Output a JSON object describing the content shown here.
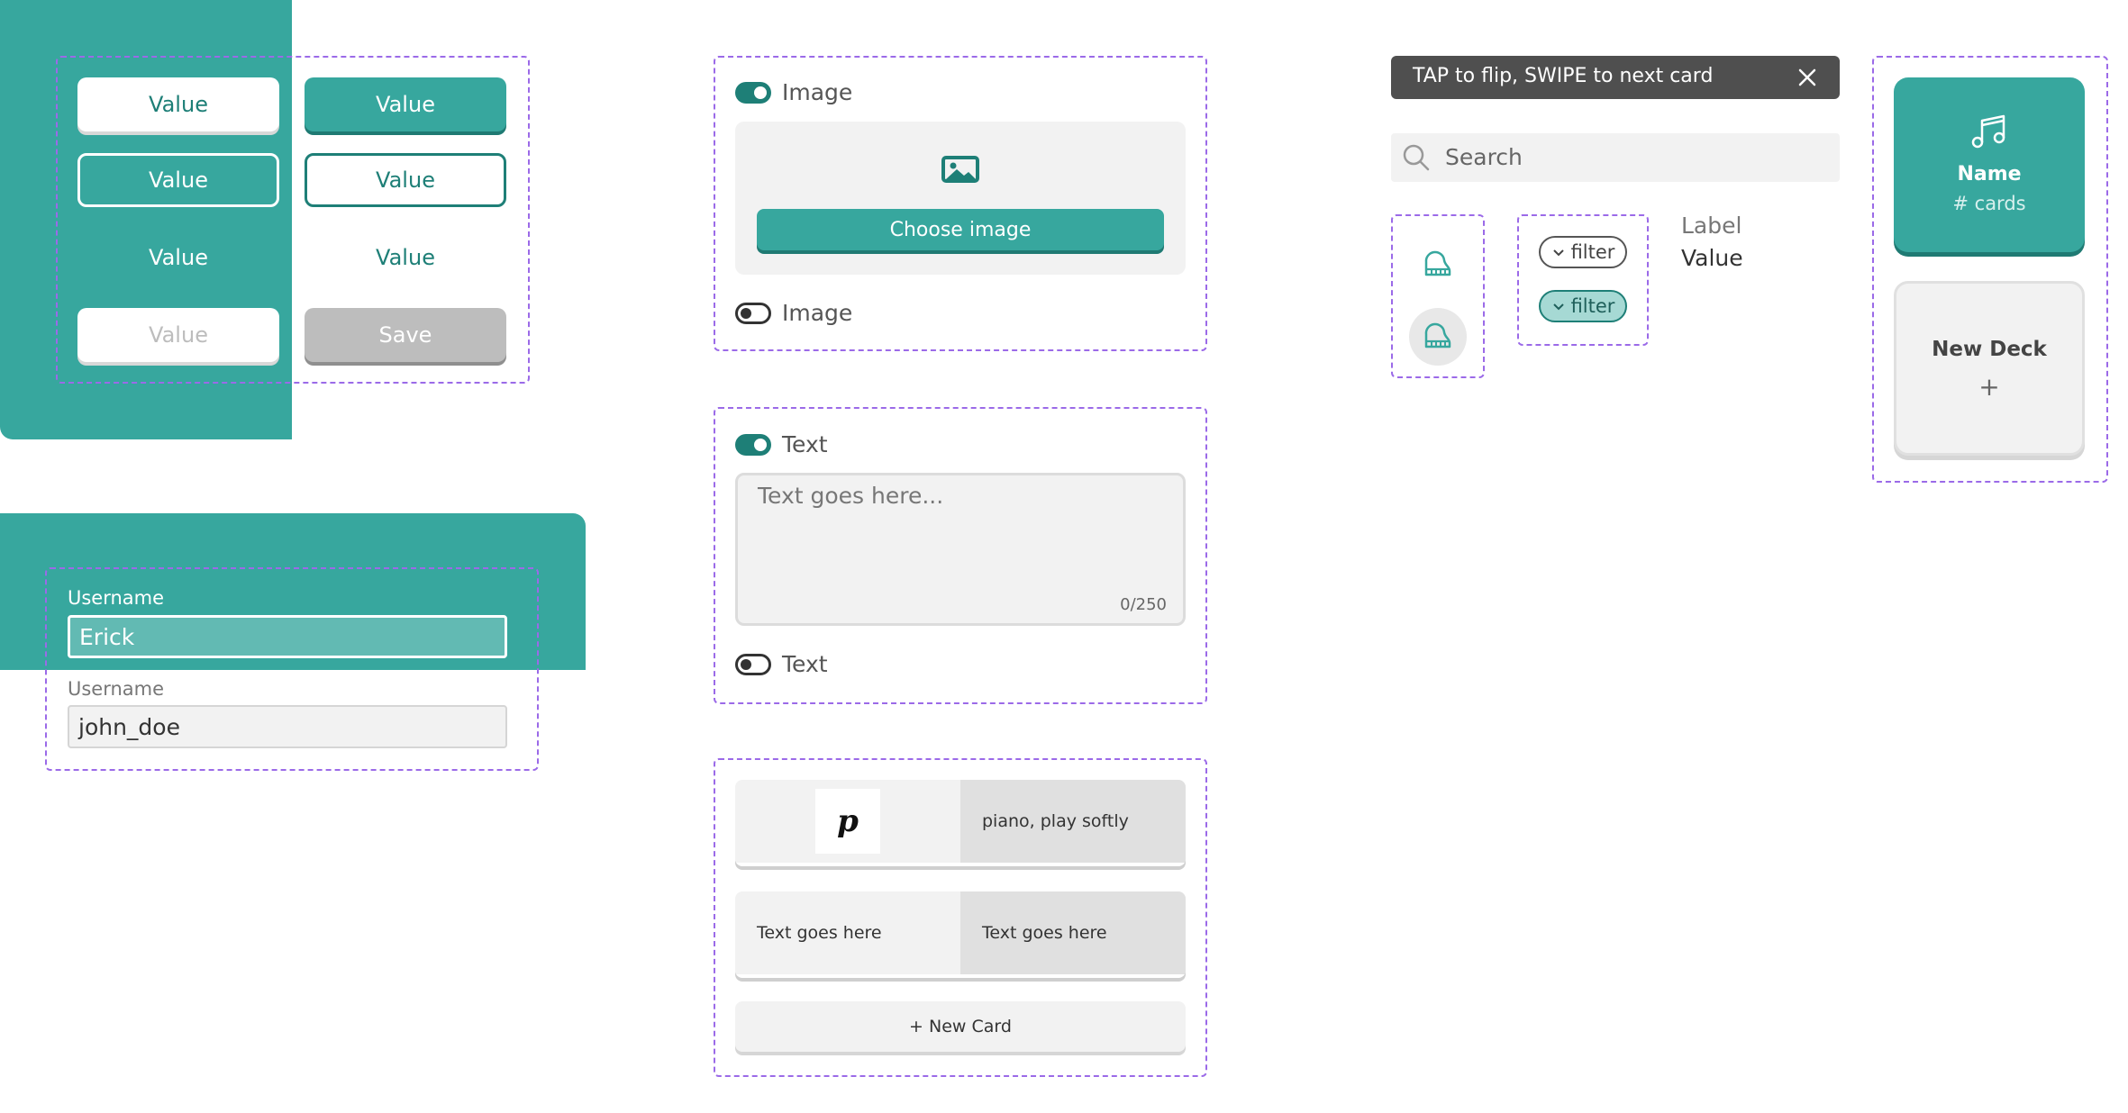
{
  "buttons": {
    "white": "Value",
    "teal": "Value",
    "outline_white": "Value",
    "outline_teal": "Value",
    "text_white": "Value",
    "text_teal": "Value",
    "disabled_white": "Value",
    "save": "Save"
  },
  "form": {
    "field1": {
      "label": "Username",
      "value": "Erick"
    },
    "field2": {
      "label": "Username",
      "value": "john_doe"
    }
  },
  "image_section": {
    "toggle_on_label": "Image",
    "choose_button": "Choose image",
    "toggle_off_label": "Image"
  },
  "text_section": {
    "toggle_on_label": "Text",
    "placeholder": "Text goes here...",
    "counter": "0/250",
    "toggle_off_label": "Text"
  },
  "cards": {
    "row1": {
      "symbol": "𝒑",
      "back": "piano, play softly"
    },
    "row2": {
      "front": "Text goes here",
      "back": "Text goes here"
    },
    "new_card": "+ New Card"
  },
  "banner": {
    "text": "TAP to flip, SWIPE to next card"
  },
  "search": {
    "placeholder": "Search"
  },
  "filters": {
    "chip1": "filter",
    "chip2": "filter"
  },
  "label_value": {
    "label": "Label",
    "value": "Value"
  },
  "decks": {
    "deck_name": "Name",
    "deck_count": "# cards",
    "new_deck": "New Deck",
    "new_deck_plus": "+"
  },
  "colors": {
    "accent": "#37a79e",
    "accent_dark": "#1e7f77",
    "dashed": "#9b6ae8"
  },
  "icons": [
    "image-icon",
    "close-icon",
    "search-icon",
    "piano-icon",
    "chevron-down-icon",
    "music-note-icon",
    "plus-icon"
  ]
}
